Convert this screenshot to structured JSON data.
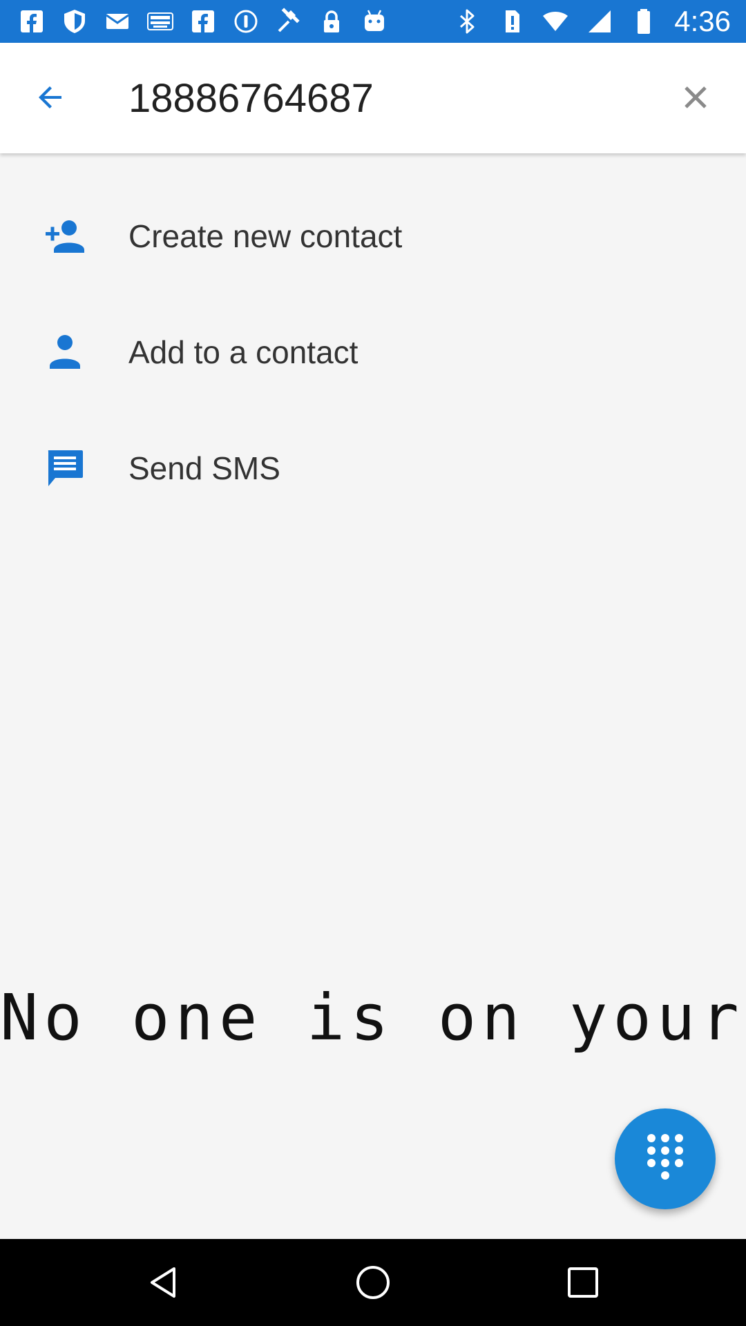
{
  "status_bar": {
    "background": "#1976d2",
    "left_icons": [
      "facebook-icon",
      "shield-icon",
      "mail-icon",
      "espn-dallas-icon",
      "facebook-icon",
      "info-circle-icon",
      "fake-gps-icon",
      "lock-icon",
      "android-icon"
    ],
    "right_icons": [
      "bluetooth-icon",
      "no-sim-icon",
      "wifi-icon",
      "signal-icon",
      "battery-icon"
    ],
    "time": "4:36"
  },
  "search": {
    "number": "18886764687",
    "back_icon": "arrow-back-icon",
    "clear_icon": "close-icon",
    "icon_color": "#1976d2"
  },
  "actions": [
    {
      "label": "Create new contact",
      "icon": "person-add-icon"
    },
    {
      "label": "Add to a contact",
      "icon": "person-icon"
    },
    {
      "label": "Send SMS",
      "icon": "message-icon"
    }
  ],
  "overlay": {
    "text": "No one is on your spe"
  },
  "fab": {
    "icon": "dialpad-icon",
    "color": "#1a88d8"
  },
  "nav_bar": {
    "back": "nav-back-icon",
    "home": "nav-home-icon",
    "recents": "nav-recents-icon"
  }
}
